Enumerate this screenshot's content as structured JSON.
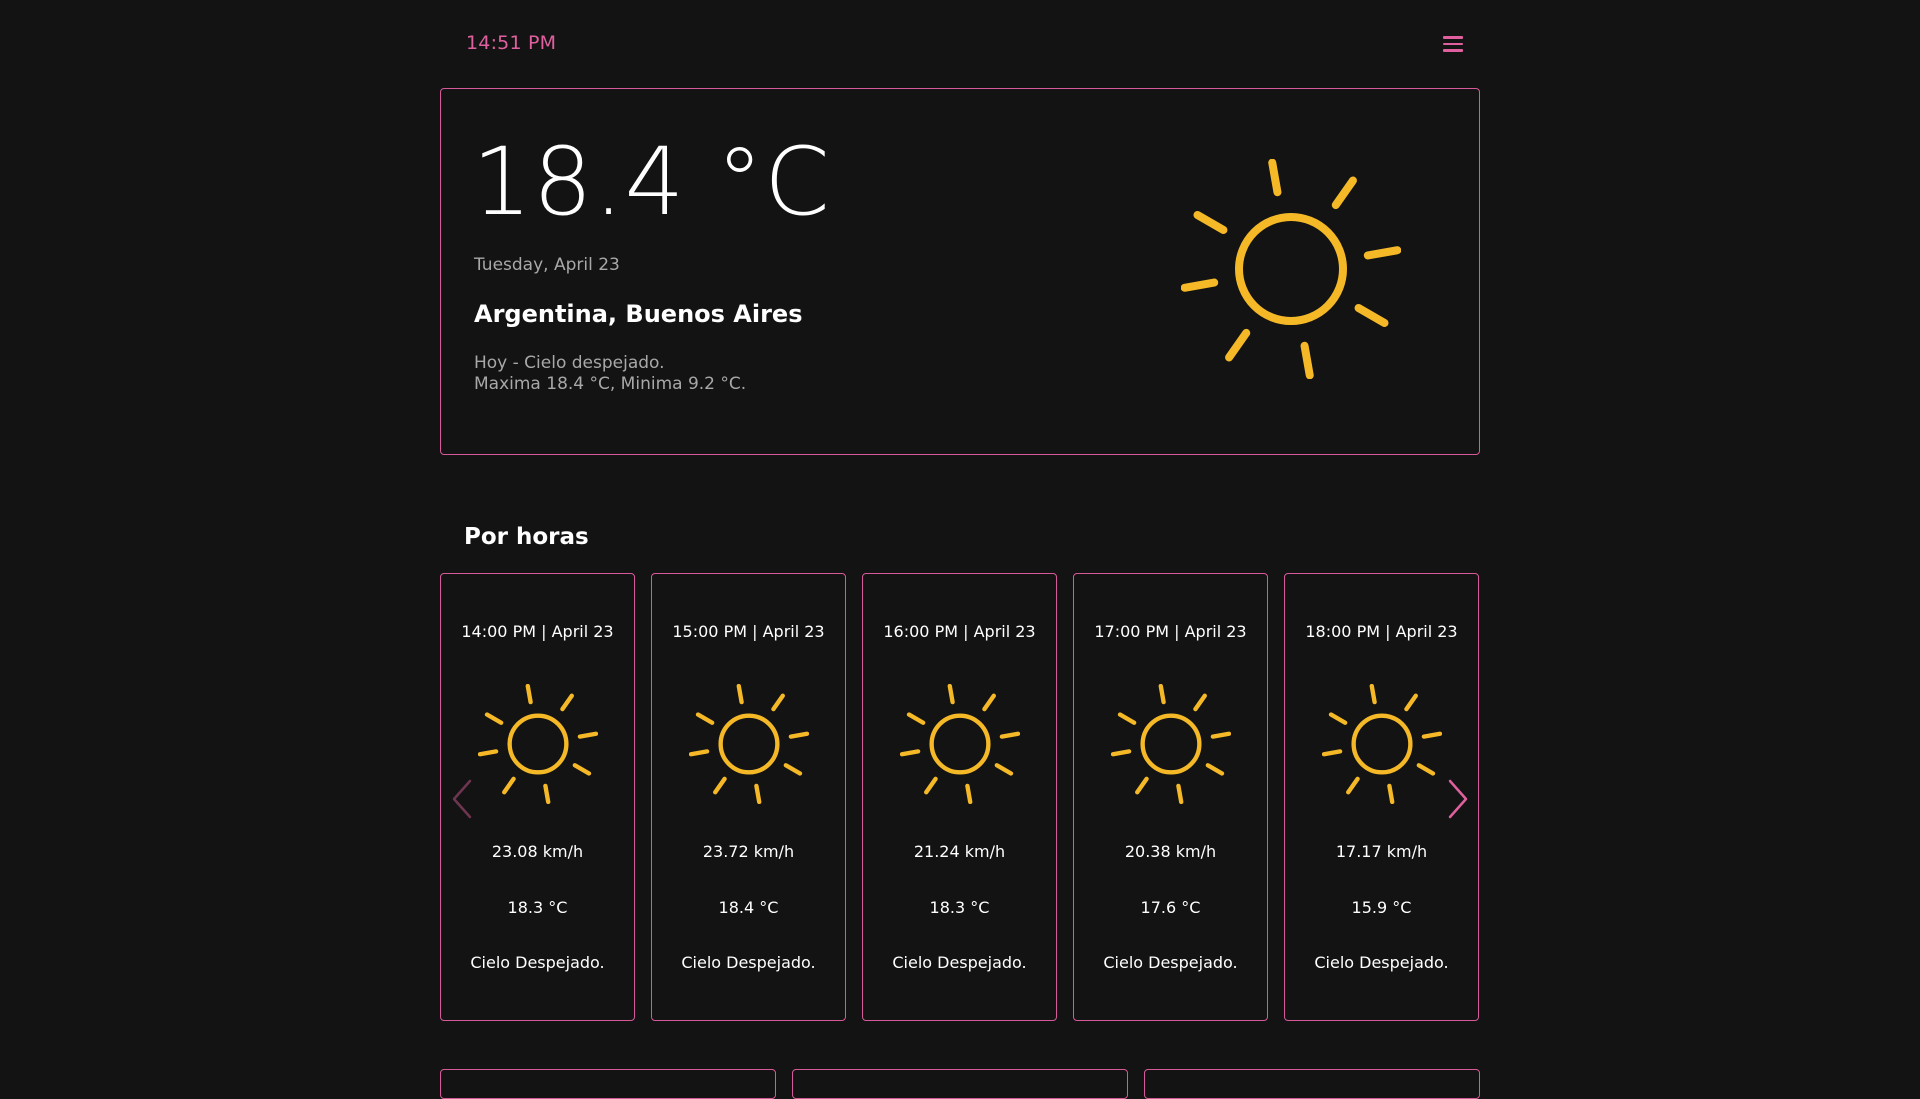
{
  "header": {
    "clock": "14:51 PM",
    "menu_icon": "hamburger-menu-icon"
  },
  "colors": {
    "accent": "#d65a99",
    "clock": "#e0609f",
    "sun": "#f5b928",
    "background": "#131313"
  },
  "current": {
    "temperature": "18.4 °C",
    "date": "Tuesday, April 23",
    "location": "Argentina, Buenos Aires",
    "summary_line1": "Hoy - Cielo despejado.",
    "summary_line2": "Maxima 18.4 °C, Minima 9.2 °C.",
    "icon": "sun-icon"
  },
  "hourly": {
    "title": "Por horas",
    "prev_icon": "chevron-left-icon",
    "next_icon": "chevron-right-icon",
    "items": [
      {
        "time": "14:00 PM | April 23",
        "wind": "23.08 km/h",
        "temp": "18.3 °C",
        "desc": "Cielo Despejado.",
        "icon": "sun-icon"
      },
      {
        "time": "15:00 PM | April 23",
        "wind": "23.72 km/h",
        "temp": "18.4 °C",
        "desc": "Cielo Despejado.",
        "icon": "sun-icon"
      },
      {
        "time": "16:00 PM | April 23",
        "wind": "21.24 km/h",
        "temp": "18.3 °C",
        "desc": "Cielo Despejado.",
        "icon": "sun-icon"
      },
      {
        "time": "17:00 PM | April 23",
        "wind": "20.38 km/h",
        "temp": "17.6 °C",
        "desc": "Cielo Despejado.",
        "icon": "sun-icon"
      },
      {
        "time": "18:00 PM | April 23",
        "wind": "17.17 km/h",
        "temp": "15.9 °C",
        "desc": "Cielo Despejado.",
        "icon": "sun-icon"
      }
    ]
  }
}
